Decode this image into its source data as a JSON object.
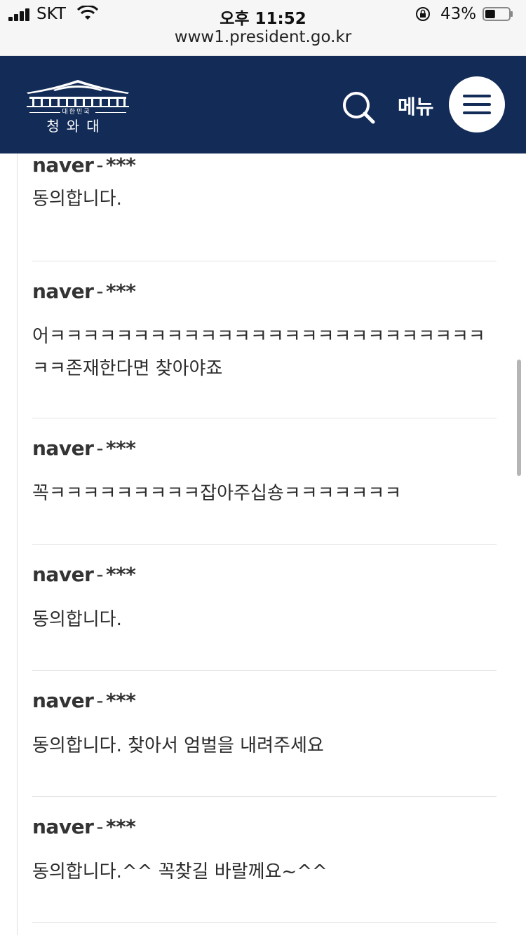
{
  "status_bar": {
    "carrier": "SKT",
    "time": "오후 11:52",
    "battery_percent": "43%",
    "battery_level": 0.43,
    "icons": [
      "signal-icon",
      "wifi-icon",
      "orientation-lock-icon",
      "battery-icon"
    ]
  },
  "browser": {
    "url": "www1.president.go.kr"
  },
  "header": {
    "logo_small": "대한민국",
    "logo_main": "청와대",
    "menu_label": "메뉴",
    "background_color": "#132c57",
    "icons": [
      "search-icon",
      "hamburger-menu-icon"
    ]
  },
  "comments": [
    {
      "source": "naver",
      "user": "***",
      "text": "동의합니다."
    },
    {
      "source": "naver",
      "user": "***",
      "text": "어ㅋㅋㅋㅋㅋㅋㅋㅋㅋㅋㅋㅋㅋㅋㅋㅋㅋㅋㅋㅋㅋㅋㅋㅋㅋㅋㅋㅋ존재한다면 찾아야죠"
    },
    {
      "source": "naver",
      "user": "***",
      "text": "꼭ㅋㅋㅋㅋㅋㅋㅋㅋㅋ잡아주십숑ㅋㅋㅋㅋㅋㅋㅋ"
    },
    {
      "source": "naver",
      "user": "***",
      "text": "동의합니다."
    },
    {
      "source": "naver",
      "user": "***",
      "text": "동의합니다. 찾아서 엄벌을 내려주세요"
    },
    {
      "source": "naver",
      "user": "***",
      "text": "동의합니다.^^ 꼭찾길 바랄께요~^^"
    }
  ]
}
